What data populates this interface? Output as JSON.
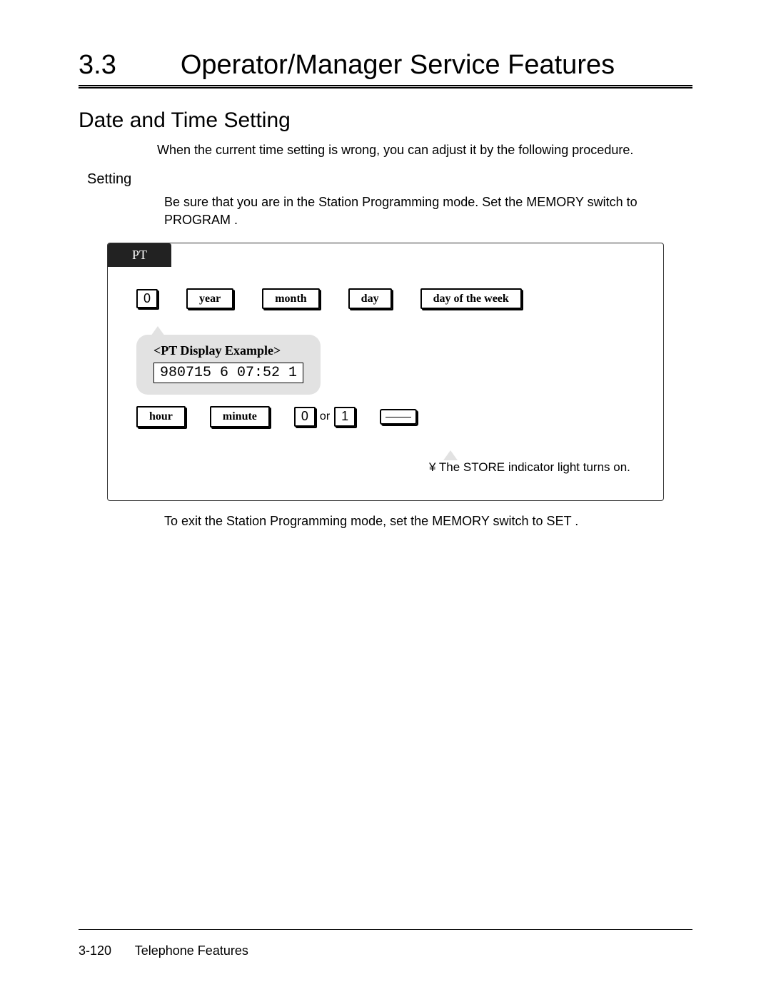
{
  "header": {
    "section_number": "3.3",
    "section_title": "Operator/Manager Service Features"
  },
  "subheading": "Date and Time Setting",
  "intro_text": "When the current time setting is wrong, you can adjust it by the following procedure.",
  "setting": {
    "label": "Setting",
    "instruction": "Be sure that you are in the Station Programming mode. Set the MEMORY switch to PROGRAM ."
  },
  "diagram": {
    "badge": "PT",
    "row1": {
      "key0": "0",
      "year": "year",
      "month": "month",
      "day": "day",
      "dow": "day of the week"
    },
    "example": {
      "title": "<PT Display Example>",
      "lcd": "980715 6 07:52 1"
    },
    "row3": {
      "hour": "hour",
      "minute": "minute",
      "key0": "0",
      "or": "or",
      "key1": "1"
    },
    "note": "¥ The STORE indicator light turns on."
  },
  "exit_text": "To exit the Station Programming mode, set the MEMORY switch to  SET .",
  "footer": {
    "page_number": "3-120",
    "book_section": "Telephone Features"
  }
}
